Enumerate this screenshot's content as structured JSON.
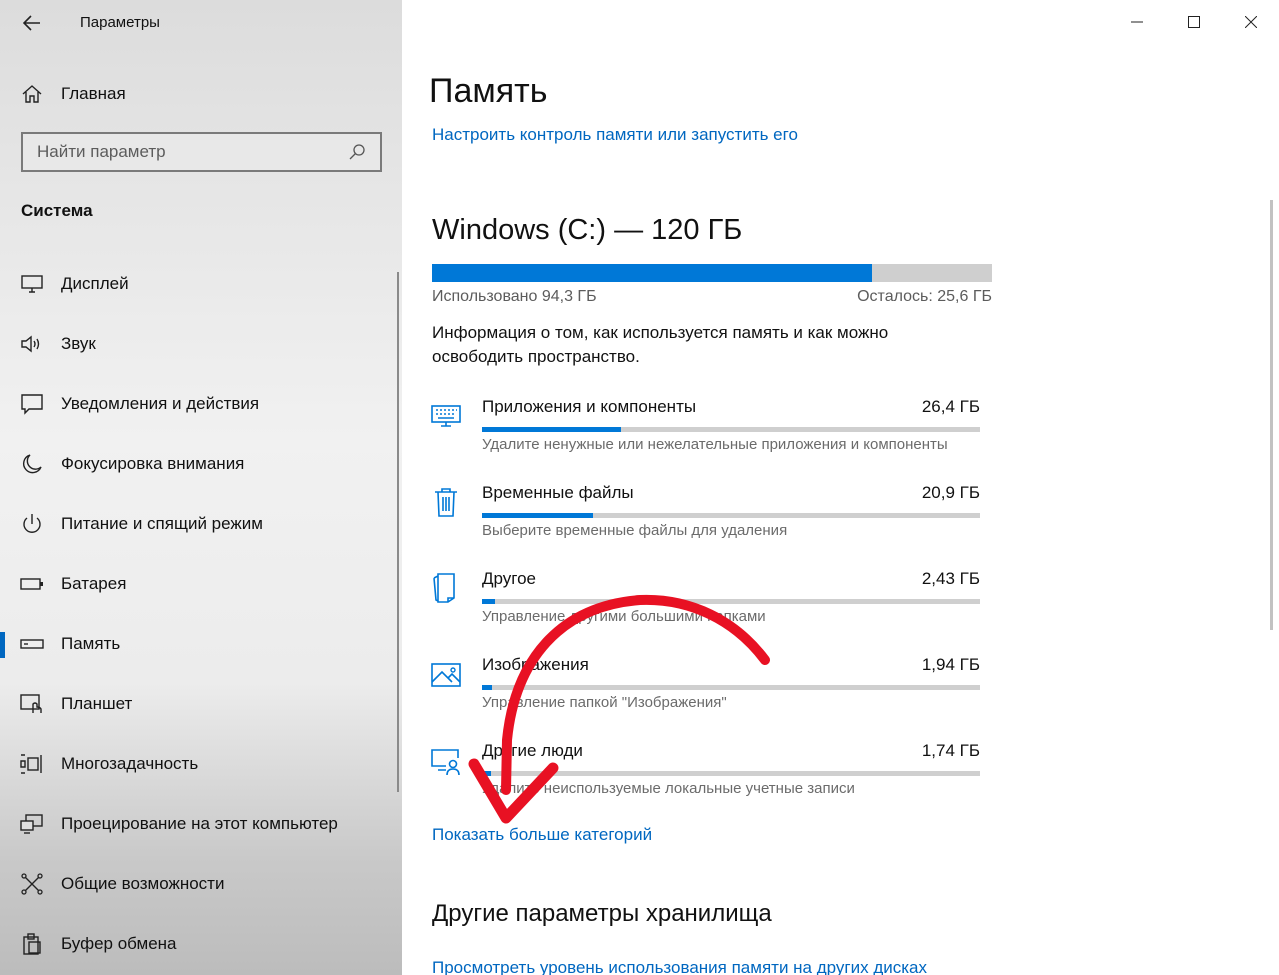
{
  "window": {
    "app_title": "Параметры",
    "minimize_icon": "minimize-icon",
    "maximize_icon": "maximize-icon",
    "close_icon": "close-icon"
  },
  "sidebar": {
    "home_label": "Главная",
    "search_placeholder": "Найти параметр",
    "section_title": "Система",
    "items": [
      {
        "label": "Дисплей",
        "icon": "monitor-icon"
      },
      {
        "label": "Звук",
        "icon": "speaker-icon"
      },
      {
        "label": "Уведомления и действия",
        "icon": "notification-icon"
      },
      {
        "label": "Фокусировка внимания",
        "icon": "moon-icon"
      },
      {
        "label": "Питание и спящий режим",
        "icon": "power-icon"
      },
      {
        "label": "Батарея",
        "icon": "battery-icon"
      },
      {
        "label": "Память",
        "icon": "storage-icon",
        "active": true
      },
      {
        "label": "Планшет",
        "icon": "tablet-icon"
      },
      {
        "label": "Многозадачность",
        "icon": "multitasking-icon"
      },
      {
        "label": "Проецирование на этот компьютер",
        "icon": "projector-icon"
      },
      {
        "label": "Общие возможности",
        "icon": "shared-experiences-icon"
      },
      {
        "label": "Буфер обмена",
        "icon": "clipboard-icon"
      }
    ]
  },
  "main": {
    "title": "Память",
    "storage_sense_link": "Настроить контроль памяти или запустить его",
    "drive": {
      "title": "Windows (C:) — 120 ГБ",
      "used_text": "Использовано 94,3 ГБ",
      "free_text": "Осталось: 25,6 ГБ",
      "used_fraction": 0.786
    },
    "info_text": "Информация о том, как используется память и как можно освободить пространство.",
    "categories": [
      {
        "name": "Приложения и компоненты",
        "size": "26,4 ГБ",
        "desc": "Удалите ненужные или нежелательные приложения и компоненты",
        "fraction": 0.28,
        "icon": "apps-icon"
      },
      {
        "name": "Временные файлы",
        "size": "20,9 ГБ",
        "desc": "Выберите временные файлы для удаления",
        "fraction": 0.222,
        "icon": "trash-icon"
      },
      {
        "name": "Другое",
        "size": "2,43 ГБ",
        "desc": "Управление другими большими папками",
        "fraction": 0.026,
        "icon": "other-icon"
      },
      {
        "name": "Изображения",
        "size": "1,94 ГБ",
        "desc": "Управление папкой \"Изображения\"",
        "fraction": 0.02,
        "icon": "pictures-icon"
      },
      {
        "name": "Другие люди",
        "size": "1,74 ГБ",
        "desc": "Удалите неиспользуемые локальные учетные записи",
        "fraction": 0.018,
        "icon": "people-icon"
      }
    ],
    "show_more_link": "Показать больше категорий",
    "other_settings_title": "Другие параметры хранилища",
    "other_disks_link": "Просмотреть уровень использования памяти на других дисках"
  },
  "colors": {
    "accent": "#0078d7",
    "link": "#0067c0",
    "annotation_arrow": "#e81123"
  }
}
